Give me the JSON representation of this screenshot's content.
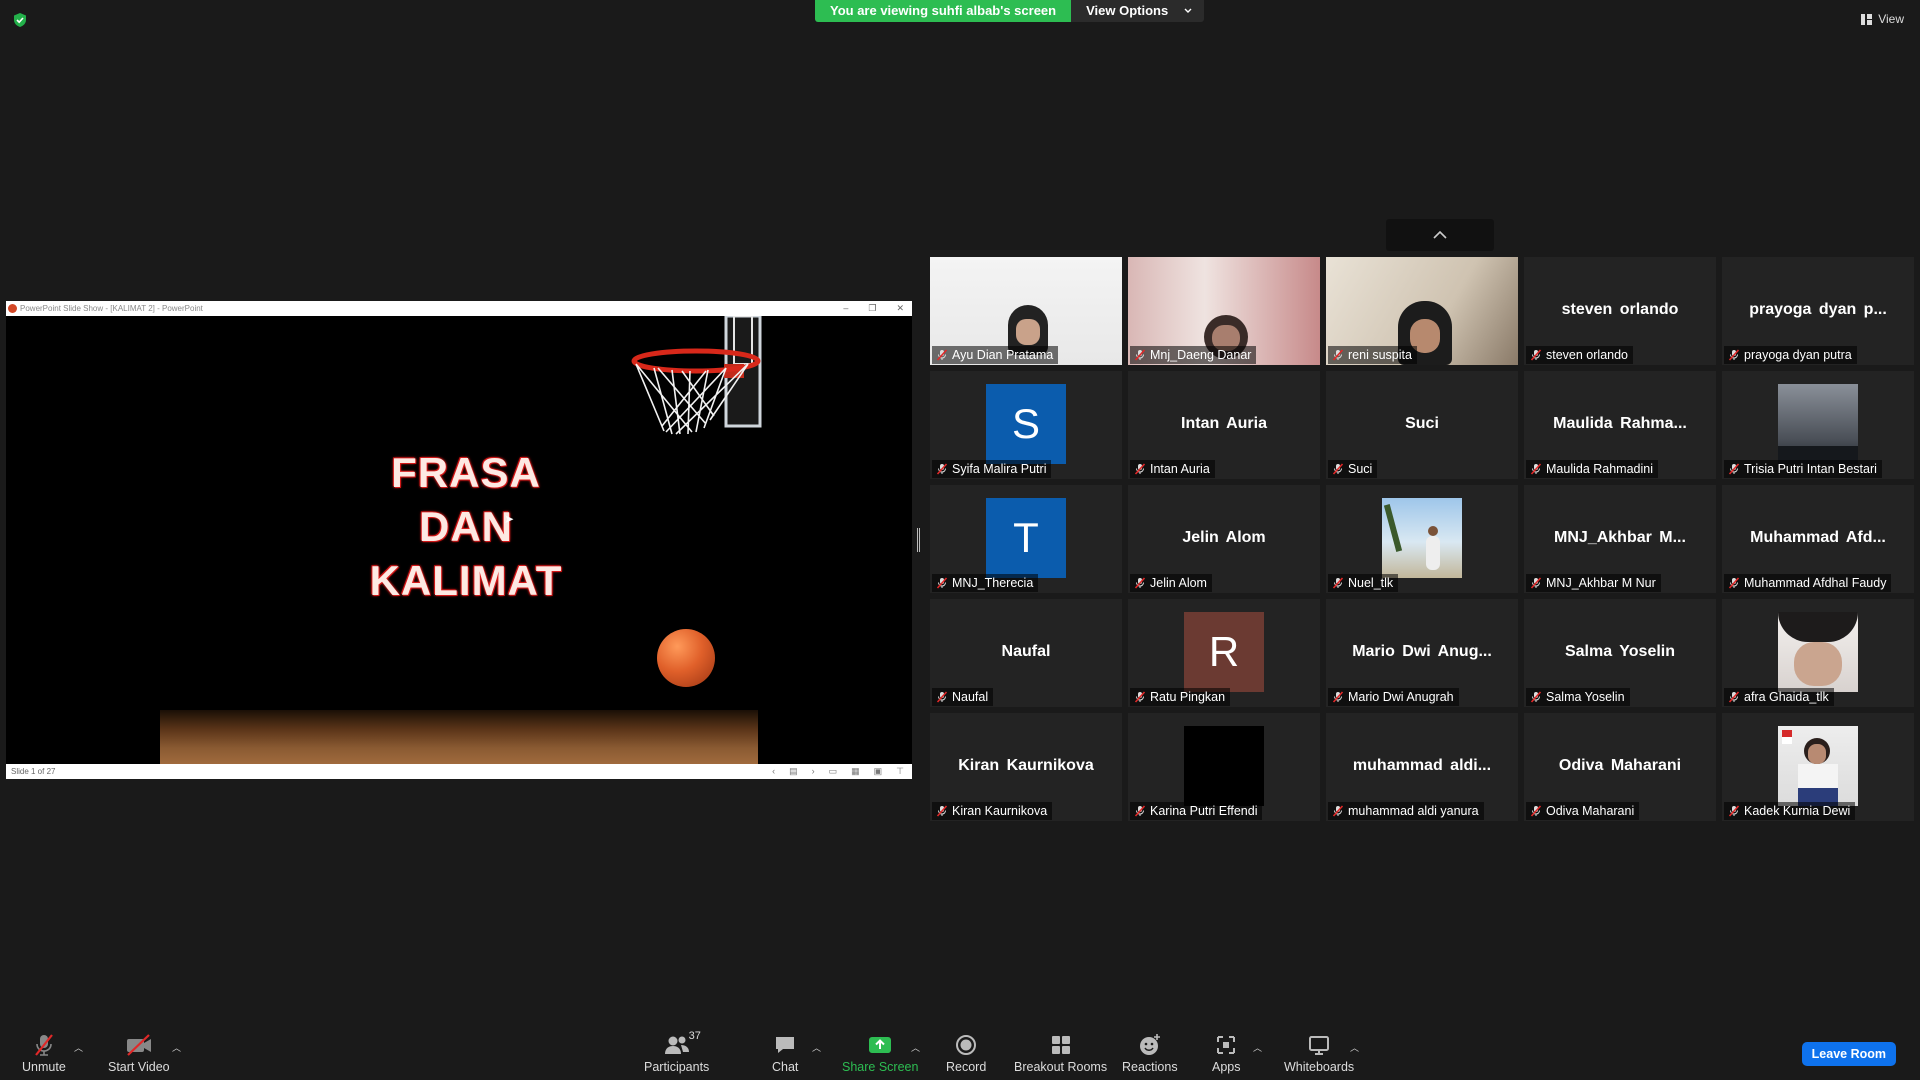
{
  "top": {
    "viewing_text": "You are viewing suhfi albab's screen",
    "view_options_label": "View Options",
    "view_label": "View"
  },
  "share": {
    "window_title": "PowerPoint Slide Show - [KALIMAT 2] - PowerPoint",
    "slide_title_lines": [
      "FRASA",
      "DAN",
      "KALIMAT"
    ],
    "slide_counter": "Slide 1 of 27"
  },
  "participants": [
    {
      "label": "Ayu Dian Pratama",
      "display": "video",
      "photo": "person-hijab"
    },
    {
      "label": "Mnj_Daeng Danar",
      "display": "video",
      "photo": "person-room"
    },
    {
      "label": "reni suspita",
      "display": "video",
      "photo": "person-hijab-light"
    },
    {
      "label": "steven orlando",
      "display": "name",
      "center": "steven orlando"
    },
    {
      "label": "prayoga dyan putra",
      "display": "name",
      "center": "prayoga dyan p..."
    },
    {
      "label": "Syifa Malira Putri",
      "display": "avatar",
      "initial": "S",
      "color": "#0b5cad"
    },
    {
      "label": "Intan Auria",
      "display": "name",
      "center": "Intan Auria"
    },
    {
      "label": "Suci",
      "display": "name",
      "center": "Suci"
    },
    {
      "label": "Maulida Rahmadini",
      "display": "name",
      "center": "Maulida Rahma..."
    },
    {
      "label": "Trisia Putri Intan Bestari",
      "display": "photo",
      "photo": "night-sky"
    },
    {
      "label": "MNJ_Therecia",
      "display": "avatar",
      "initial": "T",
      "color": "#0b5cad"
    },
    {
      "label": "Jelin Alom",
      "display": "name",
      "center": "Jelin Alom"
    },
    {
      "label": "Nuel_tlk",
      "display": "photo",
      "photo": "beach-child"
    },
    {
      "label": "MNJ_Akhbar M Nur",
      "display": "name",
      "center": "MNJ_Akhbar M..."
    },
    {
      "label": "Muhammad Afdhal Faudy",
      "display": "name",
      "center": "Muhammad Afd..."
    },
    {
      "label": "Naufal",
      "display": "name",
      "center": "Naufal"
    },
    {
      "label": "Ratu Pingkan",
      "display": "avatar",
      "initial": "R",
      "color": "#6b3a32"
    },
    {
      "label": "Mario Dwi Anugrah",
      "display": "name",
      "center": "Mario Dwi Anug..."
    },
    {
      "label": "Salma Yoselin",
      "display": "name",
      "center": "Salma Yoselin"
    },
    {
      "label": "afra Ghaida_tlk",
      "display": "photo",
      "photo": "face-closeup"
    },
    {
      "label": "Kiran Kaurnikova",
      "display": "name",
      "center": "Kiran Kaurnikova"
    },
    {
      "label": "Karina Putri Effendi",
      "display": "photo",
      "photo": "black"
    },
    {
      "label": "muhammad aldi yanura",
      "display": "name",
      "center": "muhammad aldi..."
    },
    {
      "label": "Odiva Maharani",
      "display": "name",
      "center": "Odiva Maharani"
    },
    {
      "label": "Kadek Kurnia Dewi",
      "display": "photo",
      "photo": "student-uniform"
    }
  ],
  "toolbar": {
    "unmute": "Unmute",
    "start_video": "Start Video",
    "participants": "Participants",
    "participants_count": "37",
    "chat": "Chat",
    "share_screen": "Share Screen",
    "record": "Record",
    "breakout_rooms": "Breakout Rooms",
    "reactions": "Reactions",
    "apps": "Apps",
    "whiteboards": "Whiteboards",
    "leave_room": "Leave Room"
  },
  "colors": {
    "share_green": "#2dbd52",
    "leave_blue": "#0e72ed",
    "mic_red": "#e02828"
  }
}
